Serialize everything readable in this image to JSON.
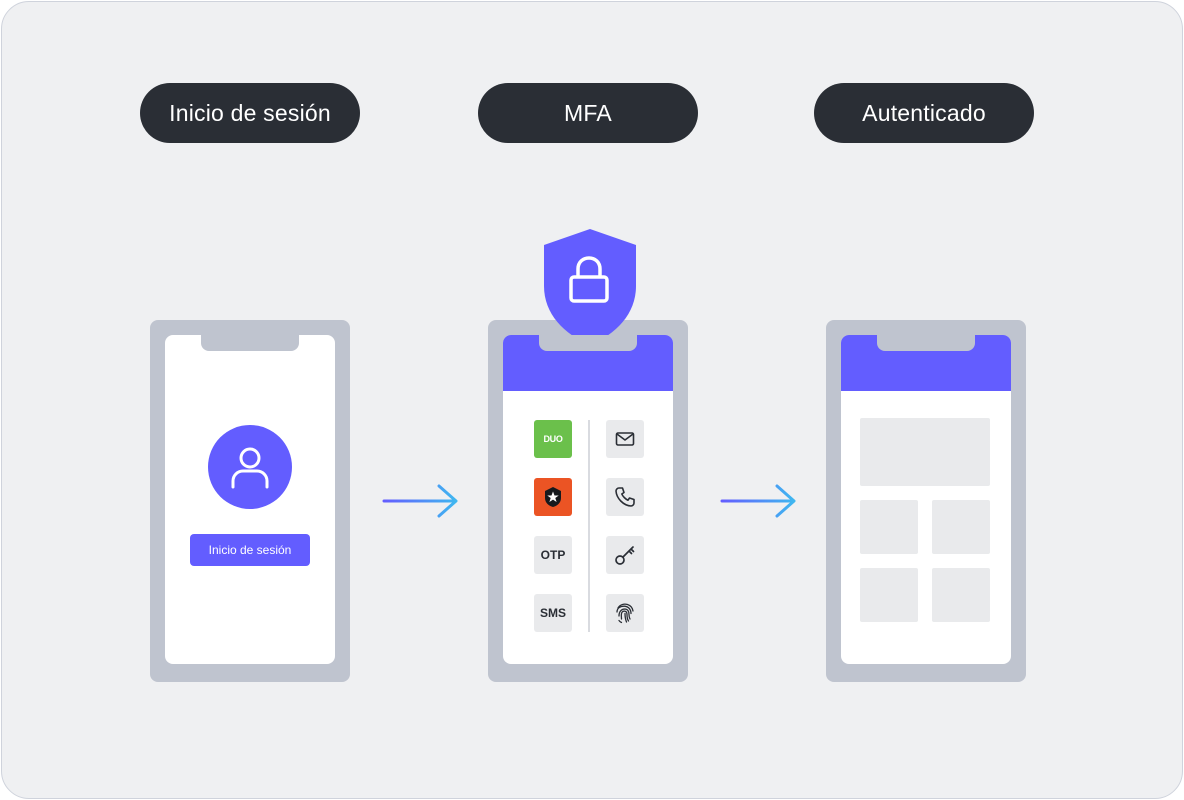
{
  "steps": [
    {
      "label": "Inicio de sesión"
    },
    {
      "label": "MFA"
    },
    {
      "label": "Autenticado"
    }
  ],
  "login_screen": {
    "button_label": "Inicio de sesión"
  },
  "mfa_screen": {
    "left_column": [
      {
        "name": "duo",
        "text": "DUO",
        "icon": "duo-logo",
        "color": "#6bc04b"
      },
      {
        "name": "auth0",
        "icon": "auth0-star-logo",
        "color": "#eb5424"
      },
      {
        "name": "otp",
        "text": "OTP"
      },
      {
        "name": "sms",
        "text": "SMS"
      }
    ],
    "right_column": [
      {
        "name": "email",
        "icon": "envelope-icon"
      },
      {
        "name": "phone",
        "icon": "phone-icon"
      },
      {
        "name": "security-key",
        "icon": "key-icon"
      },
      {
        "name": "biometric",
        "icon": "fingerprint-icon"
      }
    ]
  },
  "colors": {
    "accent": "#635dff",
    "pill": "#2a2e35",
    "background": "#eff0f2",
    "phone_frame": "#bfc4cf"
  }
}
